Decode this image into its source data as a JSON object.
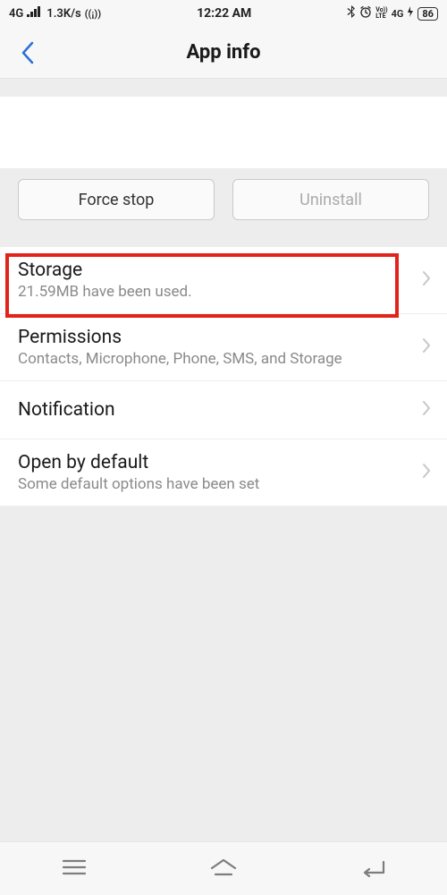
{
  "status_bar": {
    "network_type": "4G",
    "speed": "1.3K/s",
    "time": "12:22 AM",
    "lte_label": "LTE",
    "volte_label": "Vo))",
    "net4g": "4G",
    "battery": "86"
  },
  "header": {
    "title": "App info"
  },
  "actions": {
    "force_stop": "Force stop",
    "uninstall": "Uninstall"
  },
  "items": [
    {
      "title": "Storage",
      "subtitle": "21.59MB have been used.",
      "highlighted": true
    },
    {
      "title": "Permissions",
      "subtitle": "Contacts, Microphone, Phone, SMS, and Storage"
    },
    {
      "title": "Notification",
      "subtitle": ""
    },
    {
      "title": "Open by default",
      "subtitle": "Some default options have been set"
    }
  ]
}
